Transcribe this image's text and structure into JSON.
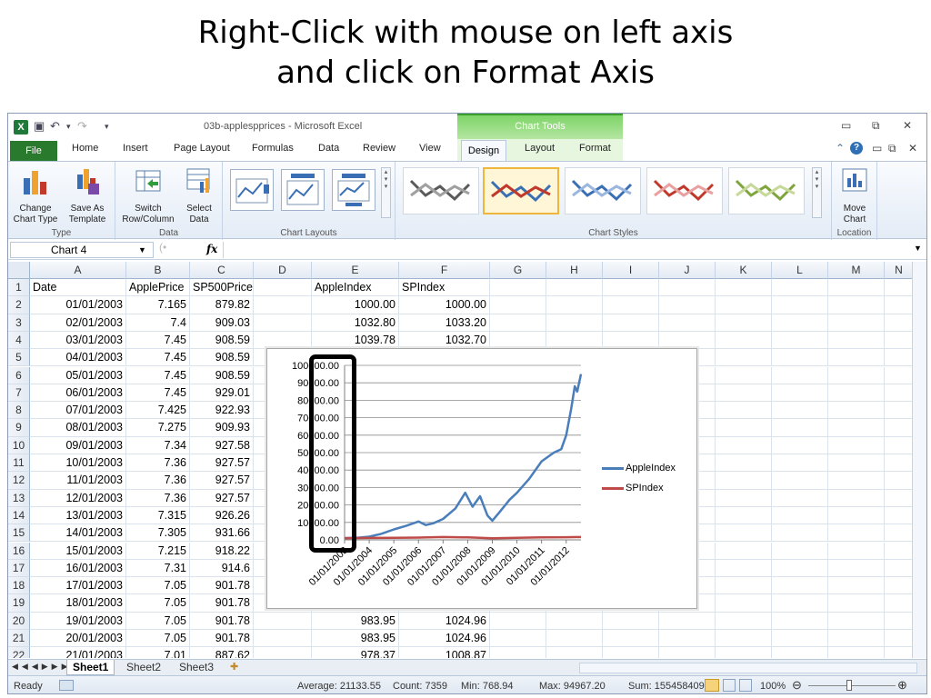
{
  "slide": {
    "title_line1": "Right-Click with mouse on left axis",
    "title_line2": "and click on Format Axis"
  },
  "window": {
    "doc_title": "03b-applespprices - Microsoft Excel",
    "chart_tools_label": "Chart Tools"
  },
  "tabs": {
    "file": "File",
    "home": "Home",
    "insert": "Insert",
    "page_layout": "Page Layout",
    "formulas": "Formulas",
    "data": "Data",
    "review": "Review",
    "view": "View",
    "design": "Design",
    "layout": "Layout",
    "format": "Format"
  },
  "ribbon": {
    "change_chart_type": [
      "Change",
      "Chart Type"
    ],
    "save_as_template": [
      "Save As",
      "Template"
    ],
    "switch_row_column": [
      "Switch",
      "Row/Column"
    ],
    "select_data": [
      "Select",
      "Data"
    ],
    "move_chart": [
      "Move",
      "Chart"
    ],
    "group_type": "Type",
    "group_data": "Data",
    "group_layouts": "Chart Layouts",
    "group_styles": "Chart Styles",
    "group_location": "Location"
  },
  "formula_bar": {
    "name_box": "Chart 4",
    "fx": "fx",
    "value": ""
  },
  "grid": {
    "columns": [
      "A",
      "B",
      "C",
      "D",
      "E",
      "F",
      "G",
      "H",
      "I",
      "J",
      "K",
      "L",
      "M",
      "N"
    ],
    "rows": [
      {
        "n": "1",
        "a": "Date",
        "b": "ApplePrice",
        "c": "SP500Price",
        "e": "AppleIndex",
        "f": "SPIndex"
      },
      {
        "n": "2",
        "a": "01/01/2003",
        "b": "7.165",
        "c": "879.82",
        "e": "1000.00",
        "f": "1000.00"
      },
      {
        "n": "3",
        "a": "02/01/2003",
        "b": "7.4",
        "c": "909.03",
        "e": "1032.80",
        "f": "1033.20"
      },
      {
        "n": "4",
        "a": "03/01/2003",
        "b": "7.45",
        "c": "908.59",
        "e": "1039.78",
        "f": "1032.70"
      },
      {
        "n": "5",
        "a": "04/01/2003",
        "b": "7.45",
        "c": "908.59",
        "e": "",
        "f": ""
      },
      {
        "n": "6",
        "a": "05/01/2003",
        "b": "7.45",
        "c": "908.59",
        "e": "",
        "f": ""
      },
      {
        "n": "7",
        "a": "06/01/2003",
        "b": "7.45",
        "c": "929.01",
        "e": "",
        "f": ""
      },
      {
        "n": "8",
        "a": "07/01/2003",
        "b": "7.425",
        "c": "922.93",
        "e": "",
        "f": ""
      },
      {
        "n": "9",
        "a": "08/01/2003",
        "b": "7.275",
        "c": "909.93",
        "e": "",
        "f": ""
      },
      {
        "n": "10",
        "a": "09/01/2003",
        "b": "7.34",
        "c": "927.58",
        "e": "",
        "f": ""
      },
      {
        "n": "11",
        "a": "10/01/2003",
        "b": "7.36",
        "c": "927.57",
        "e": "",
        "f": ""
      },
      {
        "n": "12",
        "a": "11/01/2003",
        "b": "7.36",
        "c": "927.57",
        "e": "",
        "f": ""
      },
      {
        "n": "13",
        "a": "12/01/2003",
        "b": "7.36",
        "c": "927.57",
        "e": "",
        "f": ""
      },
      {
        "n": "14",
        "a": "13/01/2003",
        "b": "7.315",
        "c": "926.26",
        "e": "",
        "f": ""
      },
      {
        "n": "15",
        "a": "14/01/2003",
        "b": "7.305",
        "c": "931.66",
        "e": "",
        "f": ""
      },
      {
        "n": "16",
        "a": "15/01/2003",
        "b": "7.215",
        "c": "918.22",
        "e": "",
        "f": ""
      },
      {
        "n": "17",
        "a": "16/01/2003",
        "b": "7.31",
        "c": "914.6",
        "e": "",
        "f": ""
      },
      {
        "n": "18",
        "a": "17/01/2003",
        "b": "7.05",
        "c": "901.78",
        "e": "",
        "f": ""
      },
      {
        "n": "19",
        "a": "18/01/2003",
        "b": "7.05",
        "c": "901.78",
        "e": "",
        "f": ""
      },
      {
        "n": "20",
        "a": "19/01/2003",
        "b": "7.05",
        "c": "901.78",
        "e": "983.95",
        "f": "1024.96"
      },
      {
        "n": "21",
        "a": "20/01/2003",
        "b": "7.05",
        "c": "901.78",
        "e": "983.95",
        "f": "1024.96"
      },
      {
        "n": "22",
        "a": "21/01/2003",
        "b": "7.01",
        "c": "887.62",
        "e": "978.37",
        "f": "1008.87"
      }
    ]
  },
  "chart_data": {
    "type": "line",
    "y_ticks": [
      "0.00",
      "10000.00",
      "20000.00",
      "30000.00",
      "40000.00",
      "50000.00",
      "60000.00",
      "70000.00",
      "80000.00",
      "90000.00",
      "100000.00"
    ],
    "ylim": [
      0,
      100000
    ],
    "x_ticks": [
      "01/01/2003",
      "01/01/2004",
      "01/01/2005",
      "01/01/2006",
      "01/01/2007",
      "01/01/2008",
      "01/01/2009",
      "01/01/2010",
      "01/01/2011",
      "01/01/2012"
    ],
    "x_years": [
      2003,
      2004,
      2005,
      2006,
      2007,
      2008,
      2009,
      2010,
      2011,
      2012
    ],
    "xlim": [
      2003,
      2012.6
    ],
    "legend_position": "right",
    "grid": true,
    "series": [
      {
        "name": "AppleIndex",
        "color": "#4a7ebb",
        "points": [
          [
            2003,
            1000
          ],
          [
            2003.5,
            1200
          ],
          [
            2004,
            1800
          ],
          [
            2004.5,
            3500
          ],
          [
            2005,
            6000
          ],
          [
            2005.5,
            8000
          ],
          [
            2006,
            10500
          ],
          [
            2006.3,
            8500
          ],
          [
            2006.6,
            9500
          ],
          [
            2007,
            12000
          ],
          [
            2007.5,
            18000
          ],
          [
            2007.9,
            27000
          ],
          [
            2008.2,
            19000
          ],
          [
            2008.5,
            25000
          ],
          [
            2008.8,
            14000
          ],
          [
            2009.0,
            11000
          ],
          [
            2009.3,
            16000
          ],
          [
            2009.7,
            23000
          ],
          [
            2010,
            27000
          ],
          [
            2010.5,
            35000
          ],
          [
            2011,
            45000
          ],
          [
            2011.5,
            50000
          ],
          [
            2011.8,
            52000
          ],
          [
            2012.0,
            60000
          ],
          [
            2012.2,
            75000
          ],
          [
            2012.35,
            88000
          ],
          [
            2012.45,
            85000
          ],
          [
            2012.6,
            95000
          ]
        ]
      },
      {
        "name": "SPIndex",
        "color": "#be4b48",
        "points": [
          [
            2003,
            1000
          ],
          [
            2004,
            1100
          ],
          [
            2005,
            1200
          ],
          [
            2006,
            1300
          ],
          [
            2007,
            1600
          ],
          [
            2008,
            1400
          ],
          [
            2009,
            900
          ],
          [
            2010,
            1200
          ],
          [
            2011,
            1400
          ],
          [
            2012,
            1500
          ],
          [
            2012.6,
            1600
          ]
        ]
      }
    ]
  },
  "sheets": {
    "sheet1": "Sheet1",
    "sheet2": "Sheet2",
    "sheet3": "Sheet3"
  },
  "status": {
    "ready": "Ready",
    "average": "Average: 21133.55",
    "count": "Count: 7359",
    "min": "Min: 768.94",
    "max": "Max: 94967.20",
    "sum": "Sum: 155458409.50",
    "zoom": "100%"
  }
}
